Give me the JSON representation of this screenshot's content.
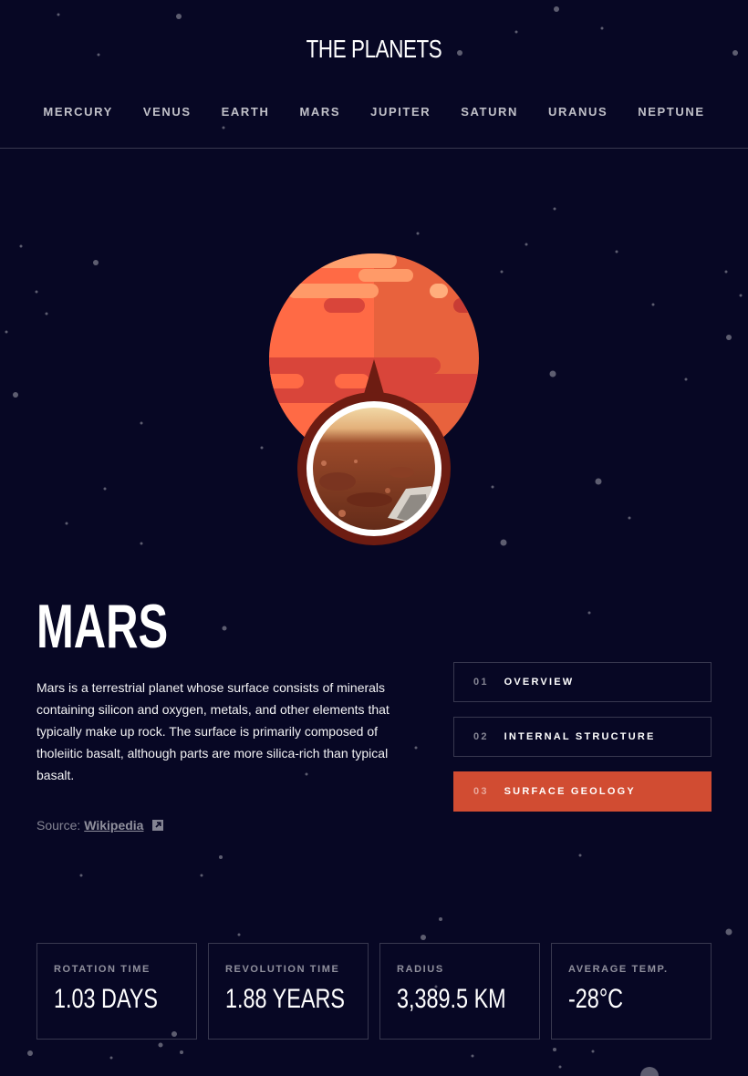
{
  "header": {
    "logo": "THE PLANETS",
    "nav": [
      "MERCURY",
      "VENUS",
      "EARTH",
      "MARS",
      "JUPITER",
      "SATURN",
      "URANUS",
      "NEPTUNE"
    ]
  },
  "planet": {
    "name": "MARS",
    "description": "Mars is a terrestrial planet whose surface consists of minerals containing silicon and oxygen, metals, and other elements that typically make up rock. The surface is primarily composed of tholeiitic basalt, although parts are more silica-rich than typical basalt.",
    "source_prefix": "Source:",
    "source_link": "Wikipedia"
  },
  "tabs": [
    {
      "num": "01",
      "label": "OVERVIEW",
      "active": false
    },
    {
      "num": "02",
      "label": "INTERNAL STRUCTURE",
      "active": false
    },
    {
      "num": "03",
      "label": "SURFACE GEOLOGY",
      "active": true
    }
  ],
  "stats": [
    {
      "label": "ROTATION TIME",
      "value": "1.03 DAYS"
    },
    {
      "label": "REVOLUTION TIME",
      "value": "1.88 YEARS"
    },
    {
      "label": "RADIUS",
      "value": "3,389.5 KM"
    },
    {
      "label": "AVERAGE TEMP.",
      "value": "-28°C"
    }
  ],
  "colors": {
    "background": "#070724",
    "accent": "#D14C32",
    "planet_light": "#FF6A45",
    "planet_dark": "#E4623C"
  }
}
